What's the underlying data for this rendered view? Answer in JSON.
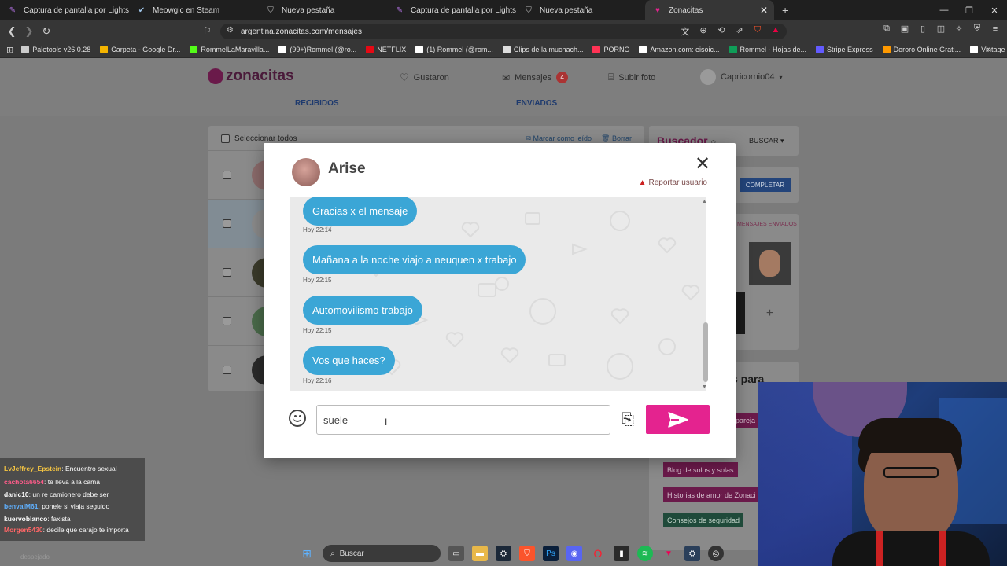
{
  "browser": {
    "tabs": [
      {
        "title": "Captura de pantalla por Lightshot",
        "icon": "feather-icon"
      },
      {
        "title": "Meowgic en Steam",
        "icon": "steam-icon"
      },
      {
        "title": "Nueva pestaña",
        "icon": "brave-icon"
      },
      {
        "title": "Captura de pantalla por Lightshot",
        "icon": "feather-icon"
      },
      {
        "title": "Nueva pestaña",
        "icon": "brave-icon"
      },
      {
        "title": "Zonacitas",
        "icon": "zonacitas-icon",
        "active": true
      }
    ],
    "new_tab": "+",
    "url": "argentina.zonacitas.com/mensajes",
    "bookmarks": [
      {
        "label": "Paletools v26.0.28",
        "color": "#cccccc"
      },
      {
        "label": "Carpeta - Google Dr...",
        "color": "#f4b400"
      },
      {
        "label": "RommelLaMaravilla...",
        "color": "#53fc18"
      },
      {
        "label": "(99+)Rommel (@ro...",
        "color": "#ffffff"
      },
      {
        "label": "NETFLIX",
        "color": "#e50914"
      },
      {
        "label": "(1) Rommel (@rom...",
        "color": "#ffffff"
      },
      {
        "label": "Clips de la muchach...",
        "color": "#dddddd"
      },
      {
        "label": "PORNO",
        "color": "#ff3355"
      },
      {
        "label": "Amazon.com: eisoic...",
        "color": "#ffffff"
      },
      {
        "label": "Rommel - Hojas de...",
        "color": "#0f9d58"
      },
      {
        "label": "Stripe Express",
        "color": "#635bff"
      },
      {
        "label": "Dororo Online Grati...",
        "color": "#ff9900"
      },
      {
        "label": "Vintage Club UK - O...",
        "color": "#ffffff"
      }
    ]
  },
  "site": {
    "logo": "zonacitas",
    "nav": {
      "gustaron": "Gustaron",
      "mensajes": "Mensajes",
      "mensajes_badge": "4",
      "subir_foto": "Subir foto",
      "user": "Capricornio04"
    },
    "tabs": {
      "recibidos": "RECIBIDOS",
      "enviados": "ENVIADOS"
    },
    "list": {
      "select_all": "Seleccionar todos",
      "mark_read": "Marcar como leído",
      "delete": "Borrar"
    },
    "sidebar": {
      "buscador": "Buscador",
      "buscar": "BUSCAR",
      "completar": "COMPLETAR",
      "enviados_label": "MENSAJES ENVIADOS",
      "add": "+",
      "para": "s para",
      "pareja": "pareja",
      "links": [
        {
          "label": "Blog de solos y solas"
        },
        {
          "label": "Historias de amor de Zonaci"
        },
        {
          "label": "Consejos de seguridad"
        }
      ]
    }
  },
  "modal": {
    "contact_name": "Arise",
    "report": "Reportar usuario",
    "messages": [
      {
        "text": "Gracias x el mensaje",
        "time": "Hoy 22:14"
      },
      {
        "text": "Mañana a la noche viajo a neuquen x trabajo",
        "time": "Hoy 22:15"
      },
      {
        "text": "Automovilismo trabajo",
        "time": "Hoy 22:15"
      },
      {
        "text": "Vos que haces?",
        "time": "Hoy 22:16"
      }
    ],
    "input_value": "suele ",
    "colors": {
      "bubble": "#3ba6d6",
      "send": "#e4238f"
    }
  },
  "stream_chat": [
    {
      "user": "LvJeffrey_Epstein",
      "user_color": "#f5c542",
      "text": "Encuentro sexual"
    },
    {
      "user": "cachota6654",
      "user_color": "#ff5c8a",
      "text": "te lleva a la cama"
    },
    {
      "user": "danic10",
      "user_color": "#ffffff",
      "text": "un re camionero debe ser"
    },
    {
      "user": "benvalM61",
      "user_color": "#5fb0ff",
      "text": "ponele si viaja seguido"
    },
    {
      "user": "kuervoblanco",
      "user_color": "#ffffff",
      "text": "faxista"
    },
    {
      "user": "Morgen5430",
      "user_color": "#ff6666",
      "text": "decile que carajo te importa"
    }
  ],
  "taskbar": {
    "search": "Buscar",
    "weather": "despejado"
  }
}
